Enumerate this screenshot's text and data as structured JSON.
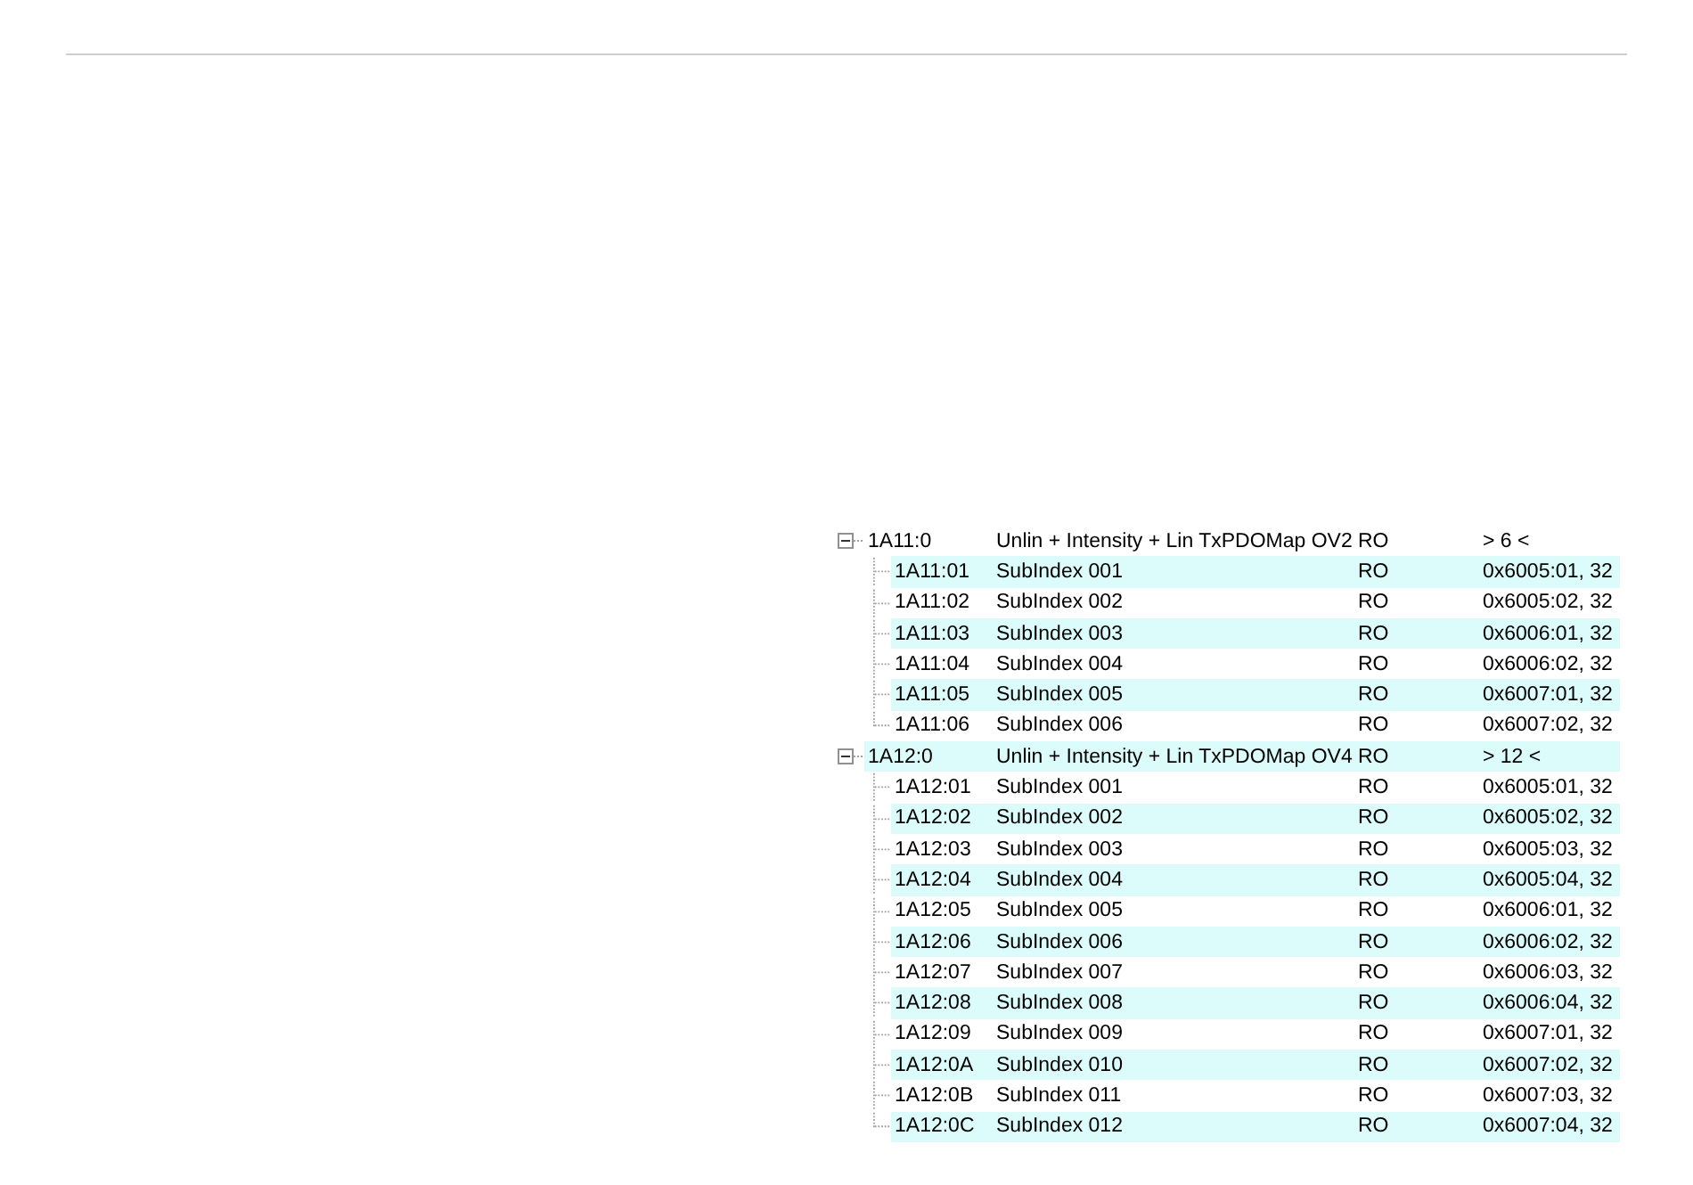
{
  "tree": {
    "rows": [
      {
        "cells": [
          "1A11:0",
          "Unlin + Intensity + Lin TxPDOMap OV2",
          "RO",
          "> 6 <"
        ],
        "expanded": true,
        "children": [
          {
            "cells": [
              "1A11:01",
              "SubIndex 001",
              "RO",
              "0x6005:01, 32"
            ]
          },
          {
            "cells": [
              "1A11:02",
              "SubIndex 002",
              "RO",
              "0x6005:02, 32"
            ]
          },
          {
            "cells": [
              "1A11:03",
              "SubIndex 003",
              "RO",
              "0x6006:01, 32"
            ]
          },
          {
            "cells": [
              "1A11:04",
              "SubIndex 004",
              "RO",
              "0x6006:02, 32"
            ]
          },
          {
            "cells": [
              "1A11:05",
              "SubIndex 005",
              "RO",
              "0x6007:01, 32"
            ]
          },
          {
            "cells": [
              "1A11:06",
              "SubIndex 006",
              "RO",
              "0x6007:02, 32"
            ]
          }
        ]
      },
      {
        "cells": [
          "1A12:0",
          "Unlin + Intensity + Lin TxPDOMap OV4",
          "RO",
          "> 12 <"
        ],
        "expanded": true,
        "children": [
          {
            "cells": [
              "1A12:01",
              "SubIndex 001",
              "RO",
              "0x6005:01, 32"
            ]
          },
          {
            "cells": [
              "1A12:02",
              "SubIndex 002",
              "RO",
              "0x6005:02, 32"
            ]
          },
          {
            "cells": [
              "1A12:03",
              "SubIndex 003",
              "RO",
              "0x6005:03, 32"
            ]
          },
          {
            "cells": [
              "1A12:04",
              "SubIndex 004",
              "RO",
              "0x6005:04, 32"
            ]
          },
          {
            "cells": [
              "1A12:05",
              "SubIndex 005",
              "RO",
              "0x6006:01, 32"
            ]
          },
          {
            "cells": [
              "1A12:06",
              "SubIndex 006",
              "RO",
              "0x6006:02, 32"
            ]
          },
          {
            "cells": [
              "1A12:07",
              "SubIndex 007",
              "RO",
              "0x6006:03, 32"
            ]
          },
          {
            "cells": [
              "1A12:08",
              "SubIndex 008",
              "RO",
              "0x6006:04, 32"
            ]
          },
          {
            "cells": [
              "1A12:09",
              "SubIndex 009",
              "RO",
              "0x6007:01, 32"
            ]
          },
          {
            "cells": [
              "1A12:0A",
              "SubIndex 010",
              "RO",
              "0x6007:02, 32"
            ]
          },
          {
            "cells": [
              "1A12:0B",
              "SubIndex 011",
              "RO",
              "0x6007:03, 32"
            ]
          },
          {
            "cells": [
              "1A12:0C",
              "SubIndex 012",
              "RO",
              "0x6007:04, 32"
            ]
          }
        ]
      }
    ]
  }
}
